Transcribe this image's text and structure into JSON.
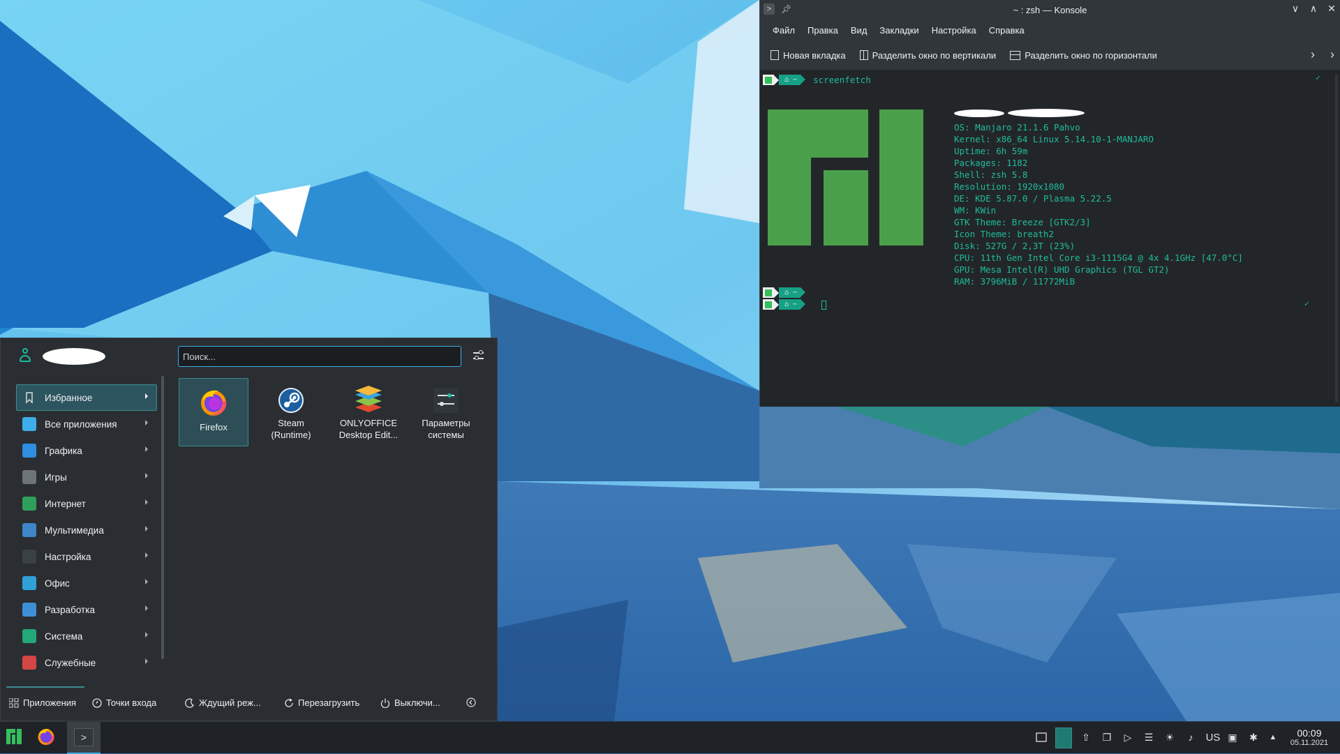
{
  "konsole": {
    "title": "~ : zsh — Konsole",
    "menu": [
      "Файл",
      "Правка",
      "Вид",
      "Закладки",
      "Настройка",
      "Справка"
    ],
    "toolbar": {
      "new_tab": "Новая вкладка",
      "split_vertical": "Разделить окно по вертикали",
      "split_horizontal": "Разделить окно по горизонтали"
    },
    "prompt_home": "~",
    "command": "screenfetch",
    "sysinfo": [
      "OS: Manjaro 21.1.6 Pahvo",
      "Kernel: x86_64 Linux 5.14.10-1-MANJARO",
      "Uptime: 6h 59m",
      "Packages: 1182",
      "Shell: zsh 5.8",
      "Resolution: 1920x1080",
      "DE: KDE 5.87.0 / Plasma 5.22.5",
      "WM: KWin",
      "GTK Theme: Breeze [GTK2/3]",
      "Icon Theme: breath2",
      "Disk: 527G / 2,3T (23%)",
      "CPU: 11th Gen Intel Core i3-1115G4 @ 4x 4.1GHz [47.0°C]",
      "GPU: Mesa Intel(R) UHD Graphics (TGL GT2)",
      "RAM: 3796MiB / 11772MiB"
    ],
    "check_mark": "✓",
    "colors": {
      "terminal_bg": "#232629",
      "terminal_fg": "#1fbc9c",
      "logo_green": "#4aa04a"
    }
  },
  "launcher": {
    "search_placeholder": "Поиск...",
    "categories": [
      {
        "label": "Избранное",
        "icon": "bookmark-icon",
        "color": "#1f2327",
        "active": true
      },
      {
        "label": "Все приложения",
        "icon": "grid-icon",
        "color": "#3daee9"
      },
      {
        "label": "Графика",
        "icon": "graphics-icon",
        "color": "#2f8ee0"
      },
      {
        "label": "Игры",
        "icon": "gamepad-icon",
        "color": "#6d7479"
      },
      {
        "label": "Интернет",
        "icon": "globe-icon",
        "color": "#2ea05c"
      },
      {
        "label": "Мультимедиа",
        "icon": "multimedia-icon",
        "color": "#3e86c8"
      },
      {
        "label": "Настройка",
        "icon": "settings-icon",
        "color": "#394046"
      },
      {
        "label": "Офис",
        "icon": "office-icon",
        "color": "#30a0d8"
      },
      {
        "label": "Разработка",
        "icon": "development-icon",
        "color": "#3d8fd6"
      },
      {
        "label": "Система",
        "icon": "system-icon",
        "color": "#23a87a"
      },
      {
        "label": "Служебные",
        "icon": "toolbox-icon",
        "color": "#d44545"
      }
    ],
    "favorites": [
      {
        "label": "Firefox",
        "icon": "firefox-icon"
      },
      {
        "label": "Steam (Runtime)",
        "icon": "steam-icon"
      },
      {
        "label": "ONLYOFFICE Desktop Edit...",
        "icon": "onlyoffice-icon"
      },
      {
        "label": "Параметры системы",
        "icon": "system-settings-icon"
      }
    ],
    "footer": {
      "applications": "Приложения",
      "places": "Точки входа",
      "sleep": "Ждущий реж...",
      "restart": "Перезагрузить",
      "shutdown": "Выключи..."
    }
  },
  "taskbar": {
    "keyboard_layout": "US",
    "time": "00:09",
    "date": "05.11.2021"
  }
}
